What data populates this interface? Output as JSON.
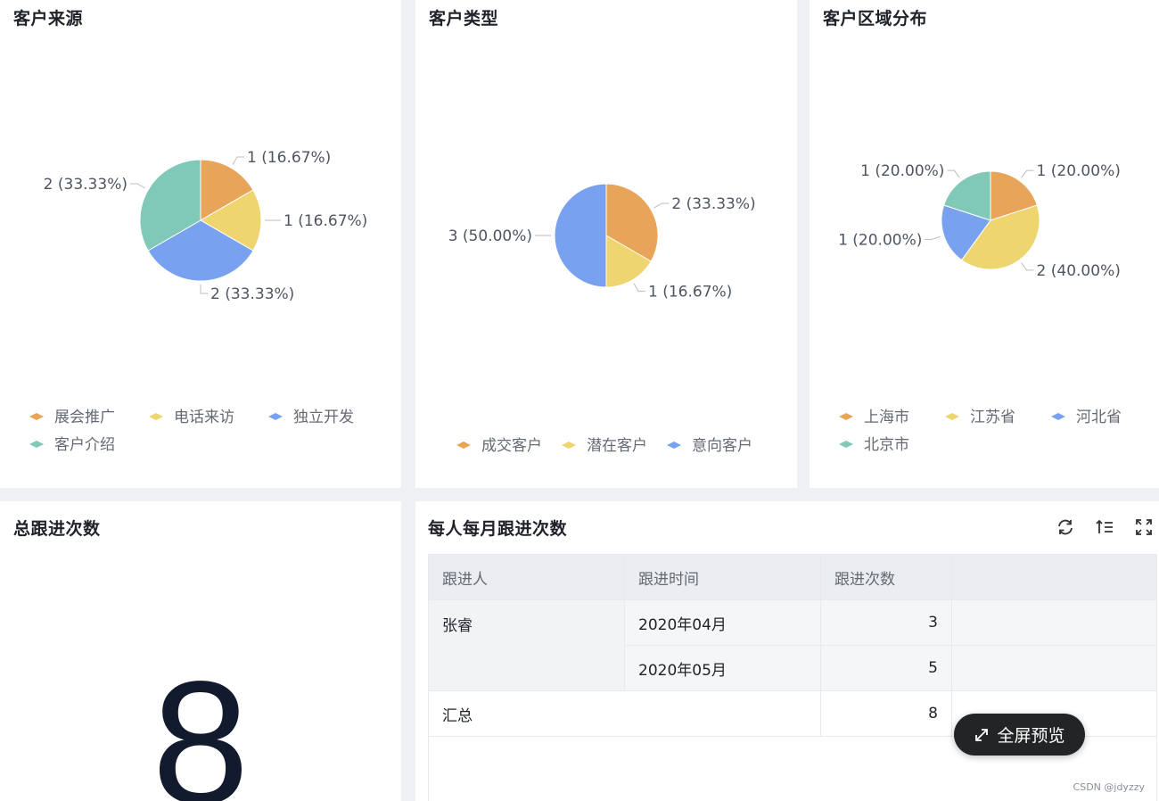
{
  "colors": {
    "orange": "#e8a459",
    "yellow": "#efd570",
    "blue": "#78a2f0",
    "teal": "#80c8b7"
  },
  "source_card": {
    "title": "客户来源",
    "chart_data": {
      "type": "pie",
      "title": "客户来源",
      "slices": [
        {
          "name": "展会推广",
          "value": 1,
          "label": "1 (16.67%)",
          "color": "#e8a459"
        },
        {
          "name": "电话来访",
          "value": 1,
          "label": "1 (16.67%)",
          "color": "#efd570"
        },
        {
          "name": "独立开发",
          "value": 2,
          "label": "2 (33.33%)",
          "color": "#78a2f0"
        },
        {
          "name": "客户介绍",
          "value": 2,
          "label": "2 (33.33%)",
          "color": "#80c8b7"
        }
      ],
      "legend": "bottom"
    }
  },
  "type_card": {
    "title": "客户类型",
    "chart_data": {
      "type": "pie",
      "title": "客户类型",
      "slices": [
        {
          "name": "成交客户",
          "value": 2,
          "label": "2 (33.33%)",
          "color": "#e8a459"
        },
        {
          "name": "潜在客户",
          "value": 1,
          "label": "1 (16.67%)",
          "color": "#efd570"
        },
        {
          "name": "意向客户",
          "value": 3,
          "label": "3 (50.00%)",
          "color": "#78a2f0"
        }
      ],
      "legend": "bottom"
    }
  },
  "region_card": {
    "title": "客户区域分布",
    "chart_data": {
      "type": "pie",
      "title": "客户区域分布",
      "slices": [
        {
          "name": "上海市",
          "value": 1,
          "label": "1 (20.00%)",
          "color": "#e8a459"
        },
        {
          "name": "江苏省",
          "value": 2,
          "label": "2 (40.00%)",
          "color": "#efd570"
        },
        {
          "name": "河北省",
          "value": 1,
          "label": "1 (20.00%)",
          "color": "#78a2f0"
        },
        {
          "name": "北京市",
          "value": 1,
          "label": "1 (20.00%)",
          "color": "#80c8b7"
        }
      ],
      "legend": "bottom"
    }
  },
  "total_card": {
    "title": "总跟进次数",
    "value": "8"
  },
  "table_card": {
    "title": "每人每月跟进次数",
    "columns": [
      "跟进人",
      "跟进时间",
      "跟进次数",
      ""
    ],
    "person": "张睿",
    "rows": [
      {
        "time": "2020年04月",
        "count": "3"
      },
      {
        "time": "2020年05月",
        "count": "5"
      }
    ],
    "summary_label": "汇总",
    "summary_count": "8",
    "tools": [
      "refresh-icon",
      "sort-icon",
      "fullscreen-icon"
    ]
  },
  "fullscreen_button": {
    "label": "全屏预览",
    "icon": "expand-arrows-icon"
  },
  "watermark": "CSDN @jdyzzy"
}
